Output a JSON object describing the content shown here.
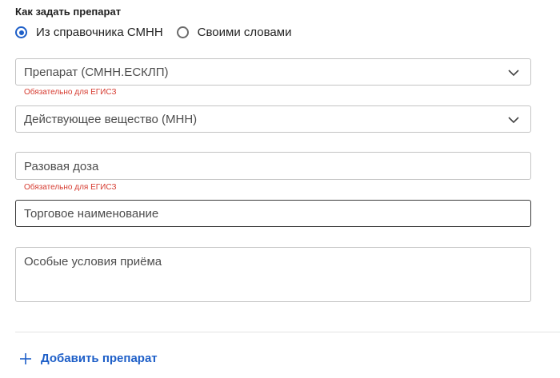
{
  "form": {
    "section_title": "Как задать препарат",
    "mode_options": [
      {
        "label": "Из справочника СМНН",
        "selected": true
      },
      {
        "label": "Своими словами",
        "selected": false
      }
    ],
    "fields": {
      "drug": {
        "placeholder": "Препарат (СМНН.ЕСКЛП)",
        "error": "Обязательно для ЕГИСЗ"
      },
      "substance": {
        "placeholder": "Действующее вещество (МНН)"
      },
      "dose": {
        "placeholder": "Разовая доза",
        "error": "Обязательно для ЕГИСЗ"
      },
      "trade_name": {
        "placeholder": "Торговое наименование"
      },
      "conditions": {
        "placeholder": "Особые условия приёма"
      }
    },
    "add_button_label": "Добавить препарат"
  },
  "colors": {
    "accent": "#1e5fc8",
    "error": "#d63b30",
    "border": "#c3c3c3"
  },
  "icons": {
    "select_arrow": "chevron-down-icon",
    "add": "plus-icon"
  }
}
